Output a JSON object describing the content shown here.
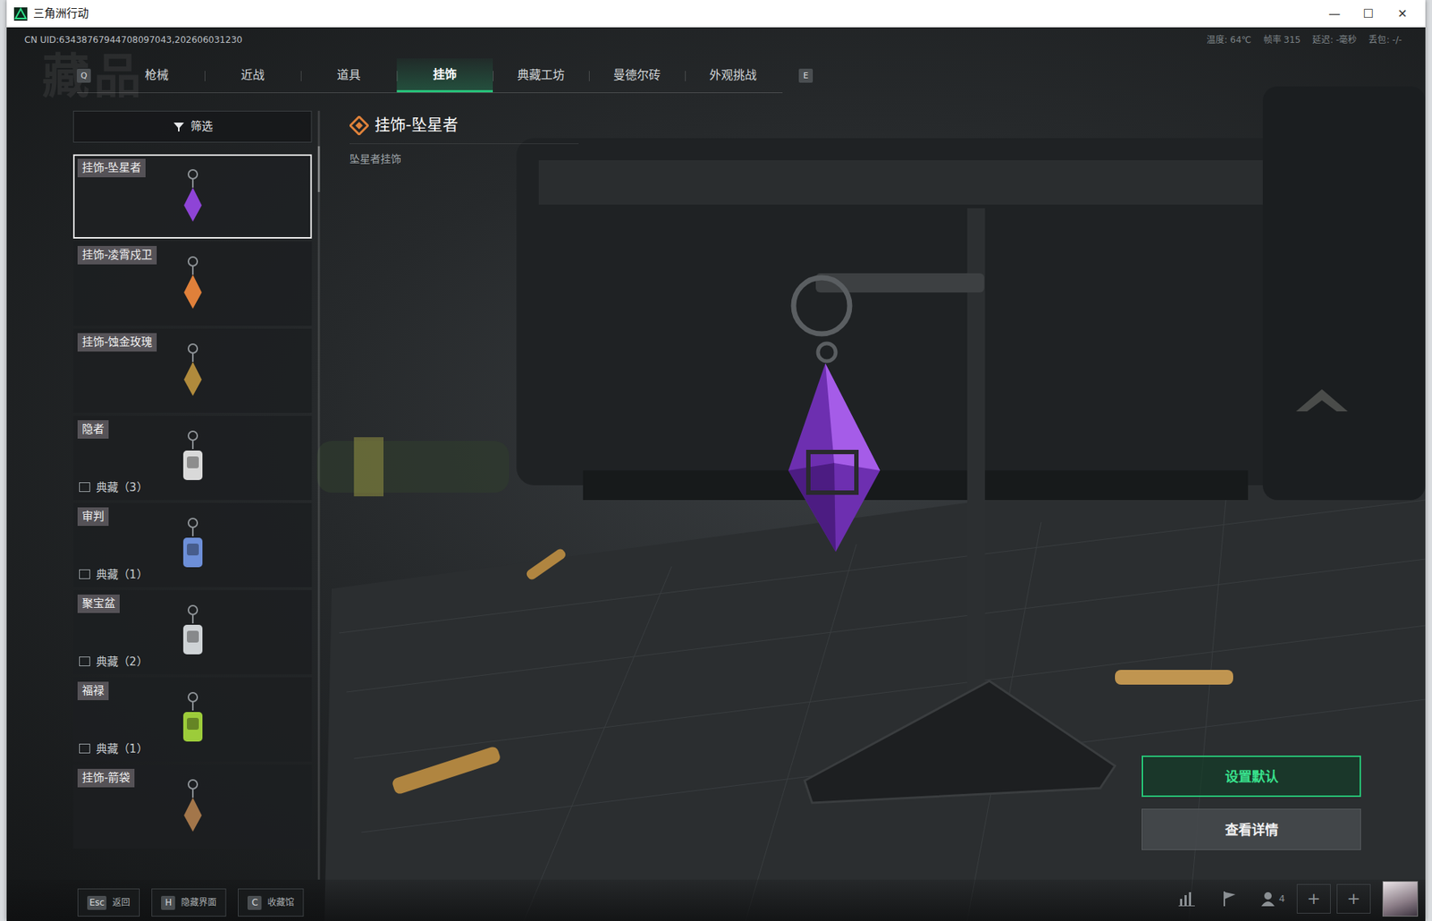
{
  "window": {
    "title": "三角洲行动",
    "controls": [
      "—",
      "☐",
      "✕"
    ]
  },
  "uid": "CN UID:63438767944708097043,202606031230",
  "watermark": "藏品",
  "stats": [
    "温度: 64℃",
    "帧率 315",
    "延迟: -毫秒",
    "丢包: -/-"
  ],
  "tabs": {
    "prev_key": "Q",
    "next_key": "E",
    "items": [
      {
        "label": "枪械",
        "selected": false
      },
      {
        "label": "近战",
        "selected": false
      },
      {
        "label": "道具",
        "selected": false
      },
      {
        "label": "挂饰",
        "selected": true
      },
      {
        "label": "典藏工坊",
        "selected": false
      },
      {
        "label": "曼德尔砖",
        "selected": false
      },
      {
        "label": "外观挑战",
        "selected": false
      }
    ]
  },
  "filter": {
    "label": "筛选"
  },
  "items": [
    {
      "name": "挂饰-坠星者",
      "kind": "plain",
      "selected": true,
      "color": "#8e44d6"
    },
    {
      "name": "挂饰-凌霄戍卫",
      "kind": "plain",
      "selected": false,
      "color": "#e0803a"
    },
    {
      "name": "挂饰-蚀金玫瑰",
      "kind": "plain",
      "selected": false,
      "color": "#b08a3c"
    },
    {
      "name": "隐者",
      "kind": "collection",
      "tag": "典藏（3）",
      "selected": false,
      "color": "#d9d9d9"
    },
    {
      "name": "审判",
      "kind": "collection",
      "tag": "典藏（1）",
      "selected": false,
      "color": "#6d8fd8"
    },
    {
      "name": "聚宝盆",
      "kind": "collection",
      "tag": "典藏（2）",
      "selected": false,
      "color": "#cfd3d6"
    },
    {
      "name": "福禄",
      "kind": "collection",
      "tag": "典藏（1）",
      "selected": false,
      "color": "#9ccc3a"
    },
    {
      "name": "挂饰-箭袋",
      "kind": "plain",
      "selected": false,
      "color": "#a3764a"
    }
  ],
  "detail": {
    "title": "挂饰-坠星者",
    "subtitle": "坠星者挂饰"
  },
  "actions": [
    {
      "label": "设置默认",
      "selected": true
    },
    {
      "label": "查看详情",
      "selected": false
    }
  ],
  "hints": [
    {
      "key": "Esc",
      "label": "返回"
    },
    {
      "key": "H",
      "label": "隐藏界面"
    },
    {
      "key": "C",
      "label": "收藏馆"
    }
  ],
  "social": {
    "friends": "4",
    "add_buttons": [
      "+",
      "+"
    ]
  }
}
